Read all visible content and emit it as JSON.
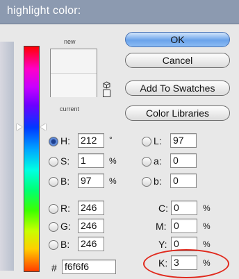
{
  "dialog": {
    "title": "highlight color:"
  },
  "swatch": {
    "new_label": "new",
    "current_label": "current",
    "new_color": "#f4f4f4",
    "current_color": "#f6f6f6"
  },
  "buttons": {
    "ok": "OK",
    "cancel": "Cancel",
    "add_to_swatches": "Add To Swatches",
    "color_libraries": "Color Libraries"
  },
  "hsb": {
    "h": {
      "label": "H:",
      "value": "212",
      "unit": "°"
    },
    "s": {
      "label": "S:",
      "value": "1",
      "unit": "%"
    },
    "b": {
      "label": "B:",
      "value": "97",
      "unit": "%"
    }
  },
  "rgb": {
    "r": {
      "label": "R:",
      "value": "246"
    },
    "g": {
      "label": "G:",
      "value": "246"
    },
    "b": {
      "label": "B:",
      "value": "246"
    }
  },
  "lab": {
    "l": {
      "label": "L:",
      "value": "97"
    },
    "a": {
      "label": "a:",
      "value": "0"
    },
    "b": {
      "label": "b:",
      "value": "0"
    }
  },
  "cmyk": {
    "c": {
      "label": "C:",
      "value": "0",
      "unit": "%"
    },
    "m": {
      "label": "M:",
      "value": "0",
      "unit": "%"
    },
    "y": {
      "label": "Y:",
      "value": "0",
      "unit": "%"
    },
    "k": {
      "label": "K:",
      "value": "3",
      "unit": "%"
    }
  },
  "hex": {
    "label": "#",
    "value": "f6f6f6"
  },
  "selected_mode": "H",
  "annotation_color": "#e02a1e"
}
